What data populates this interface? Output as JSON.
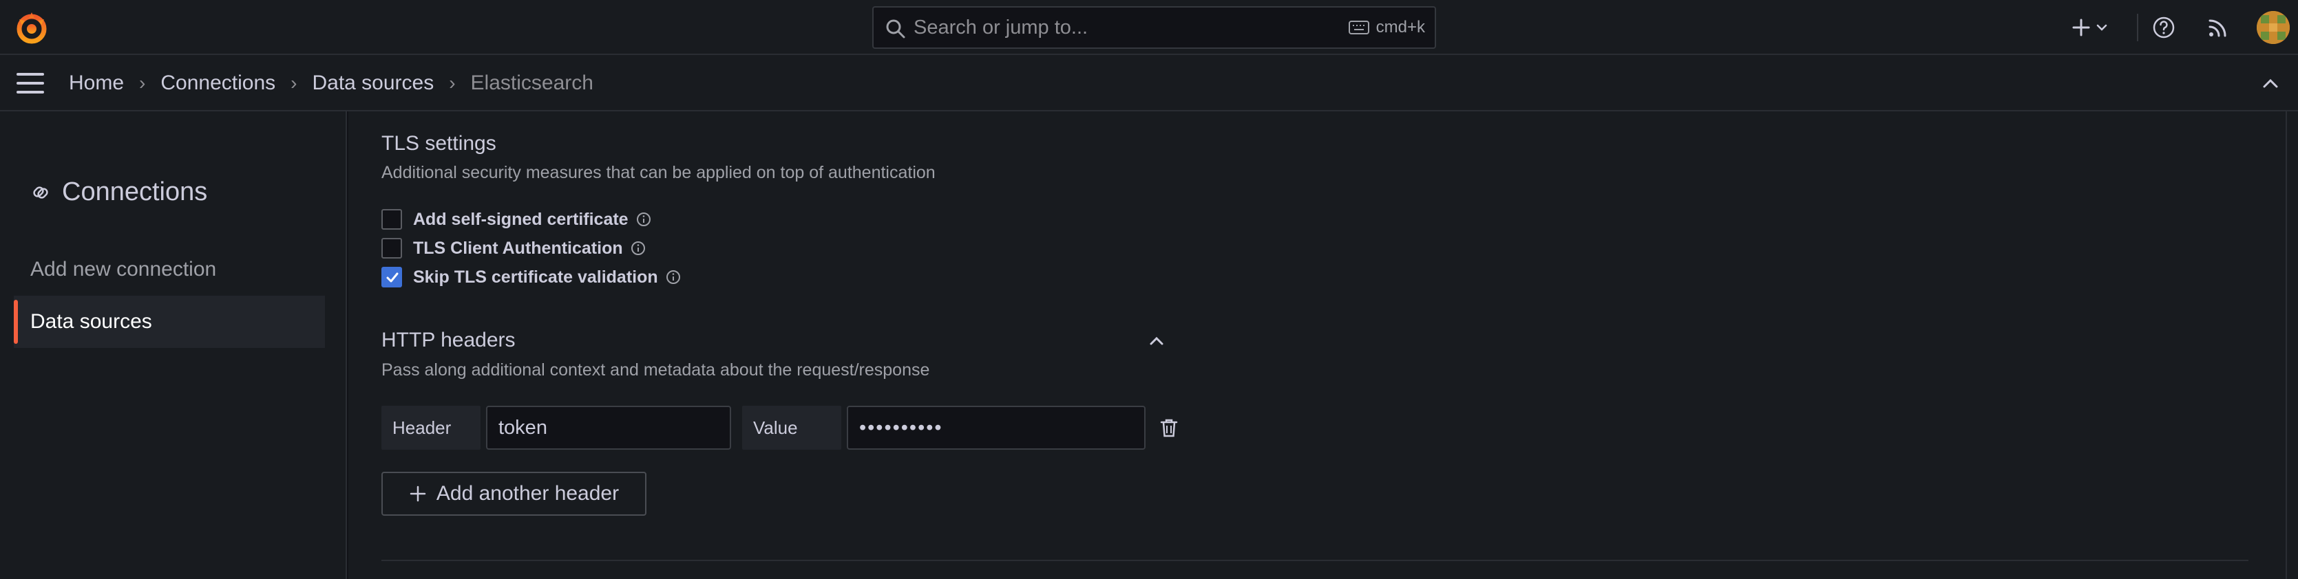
{
  "search": {
    "placeholder": "Search or jump to...",
    "shortcut": "cmd+k"
  },
  "breadcrumb": {
    "items": [
      "Home",
      "Connections",
      "Data sources"
    ],
    "current": "Elasticsearch"
  },
  "sidebar": {
    "title": "Connections",
    "items": [
      {
        "label": "Add new connection",
        "active": false
      },
      {
        "label": "Data sources",
        "active": true
      }
    ]
  },
  "tls": {
    "title": "TLS settings",
    "description": "Additional security measures that can be applied on top of authentication",
    "options": [
      {
        "label": "Add self-signed certificate",
        "checked": false
      },
      {
        "label": "TLS Client Authentication",
        "checked": false
      },
      {
        "label": "Skip TLS certificate validation",
        "checked": true
      }
    ]
  },
  "http_headers": {
    "title": "HTTP headers",
    "description": "Pass along additional context and metadata about the request/response",
    "header_label": "Header",
    "header_value": "token",
    "value_label": "Value",
    "value_masked": "••••••••••",
    "add_button": "Add another header"
  },
  "colors": {
    "accent": "#f55f3e",
    "checkbox": "#3d71d9",
    "background": "#181b1f"
  }
}
